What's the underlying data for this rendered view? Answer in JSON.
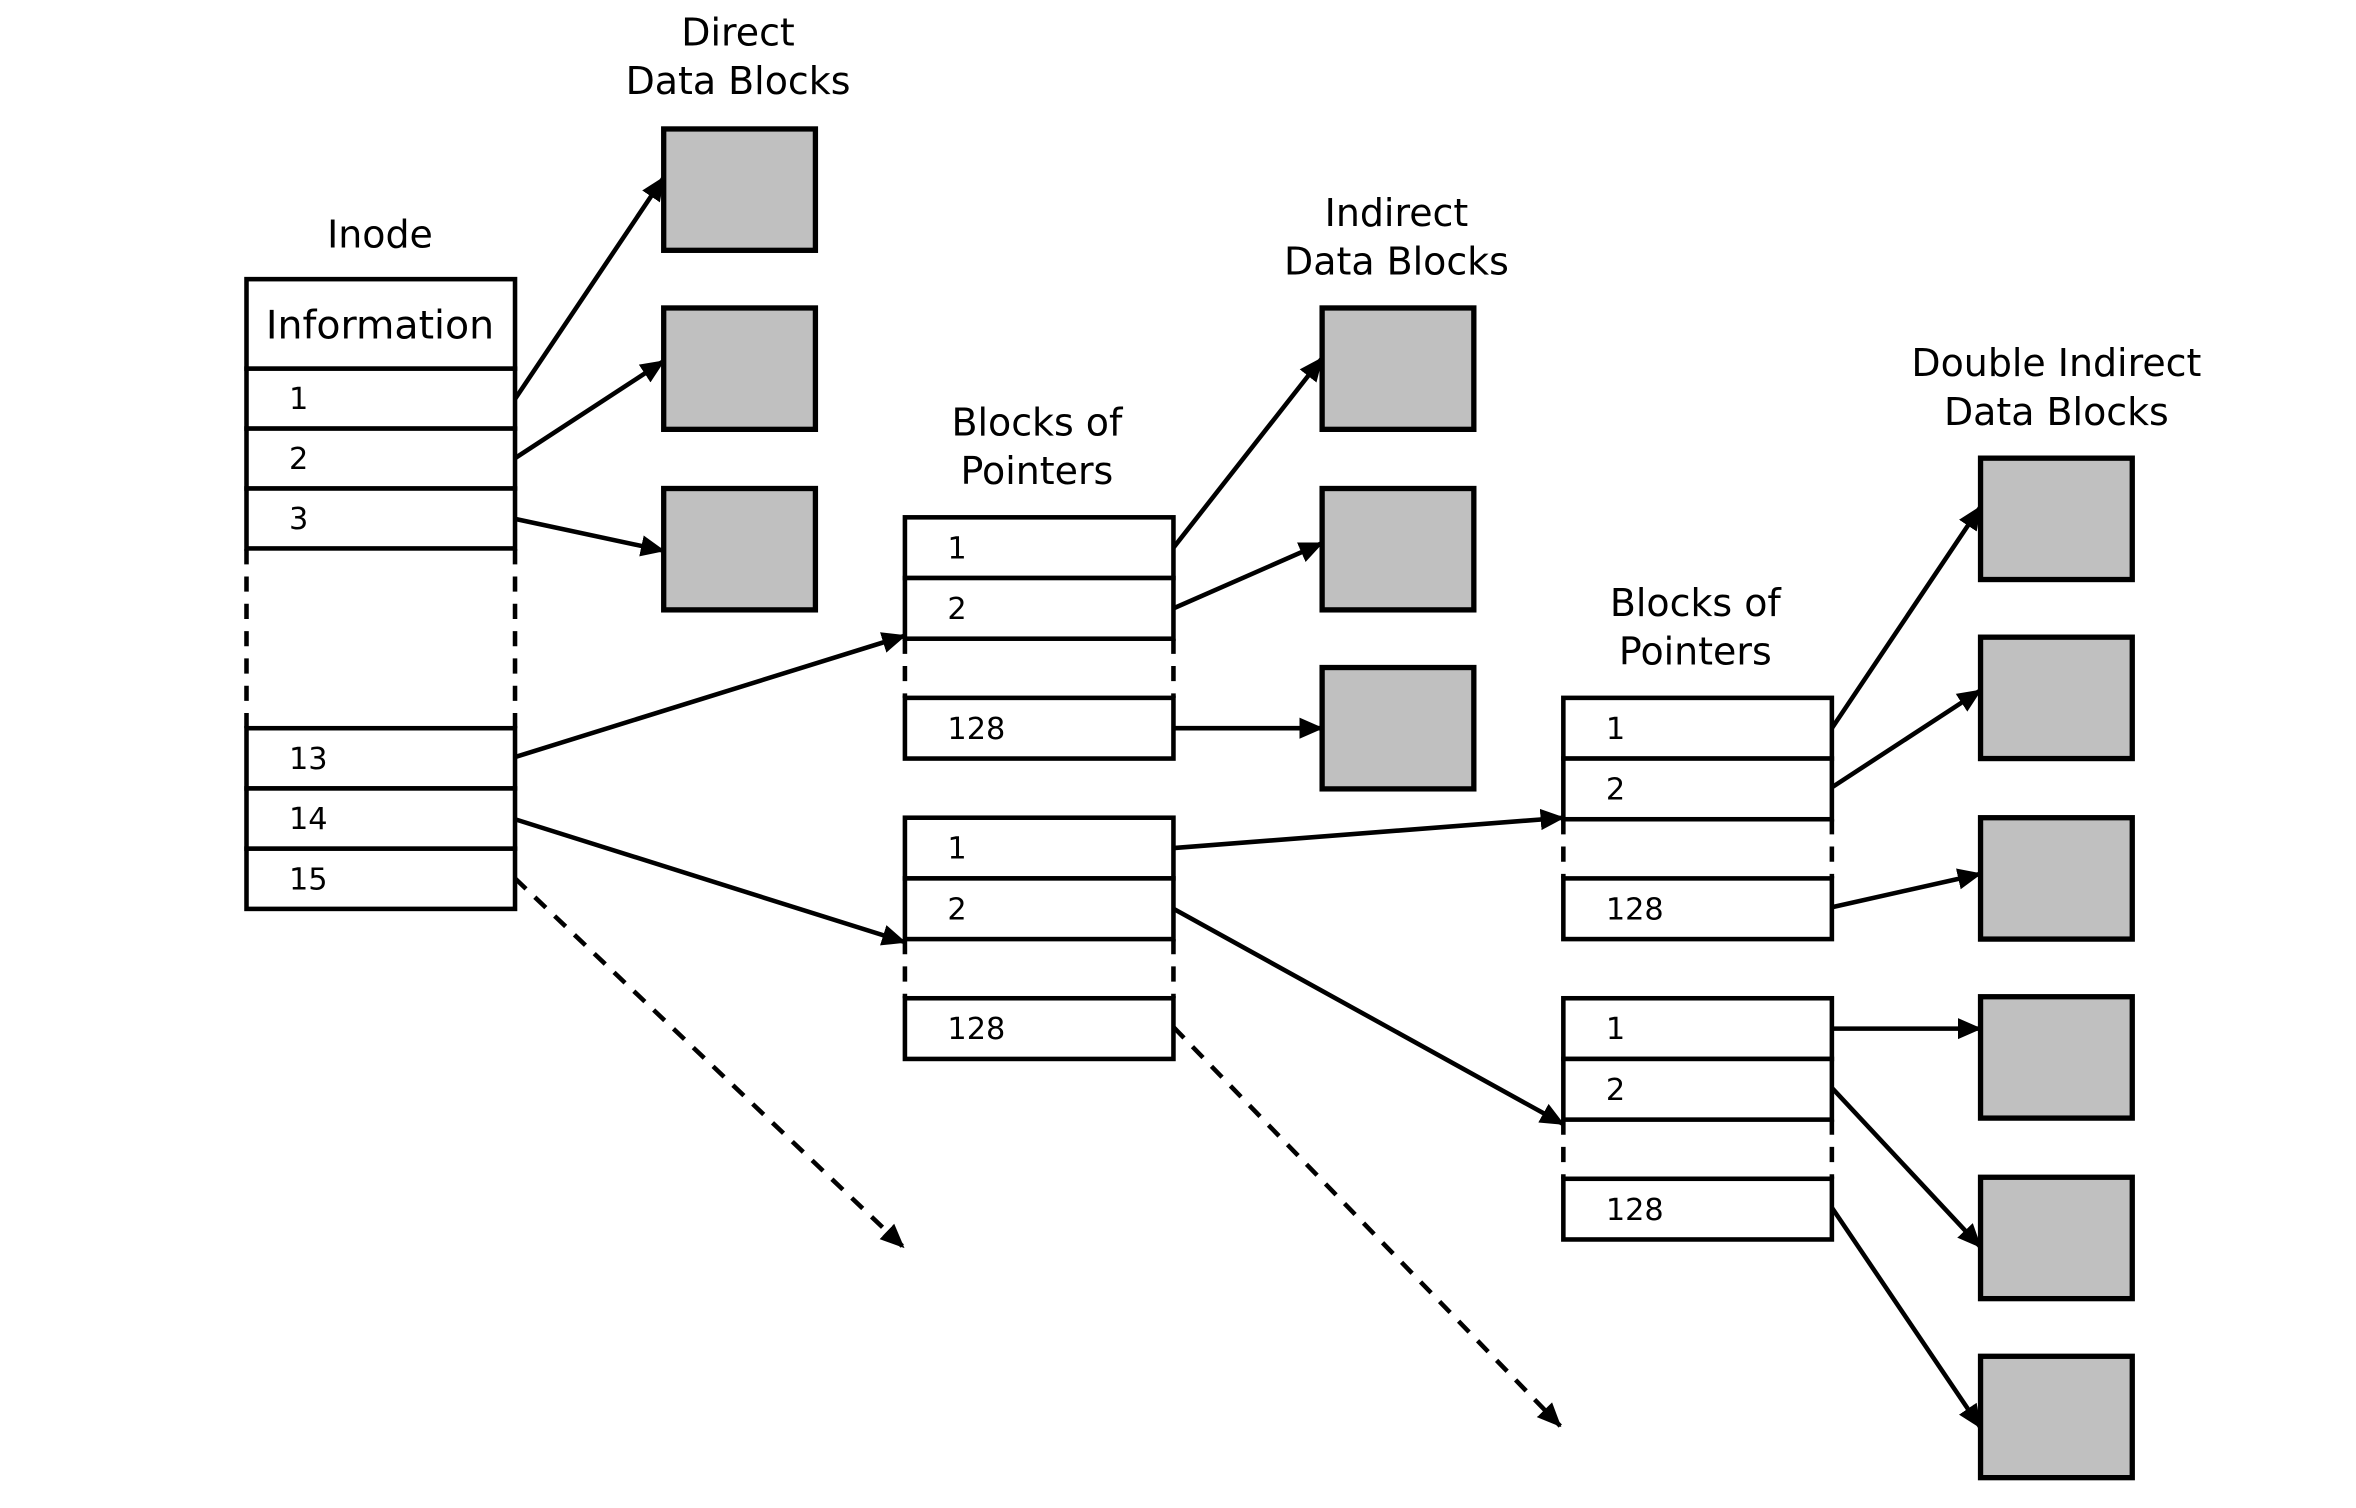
{
  "labels": {
    "direct": [
      "Direct",
      "Data Blocks"
    ],
    "inode": [
      "Inode"
    ],
    "pointers_1": [
      "Blocks of",
      "Pointers"
    ],
    "indirect": [
      "Indirect",
      "Data Blocks"
    ],
    "pointers_2": [
      "Blocks of",
      "Pointers"
    ],
    "double_indirect": [
      "Double Indirect",
      "Data Blocks"
    ]
  },
  "inode": {
    "info_label": "Information",
    "entries_top": [
      "1",
      "2",
      "3"
    ],
    "entries_bottom": [
      "13",
      "14",
      "15"
    ]
  },
  "pointer_block": {
    "entries_top": [
      "1",
      "2"
    ],
    "entries_last": "128"
  },
  "colors": {
    "data_block_fill": "#c0c0c0",
    "stroke": "#000000"
  }
}
